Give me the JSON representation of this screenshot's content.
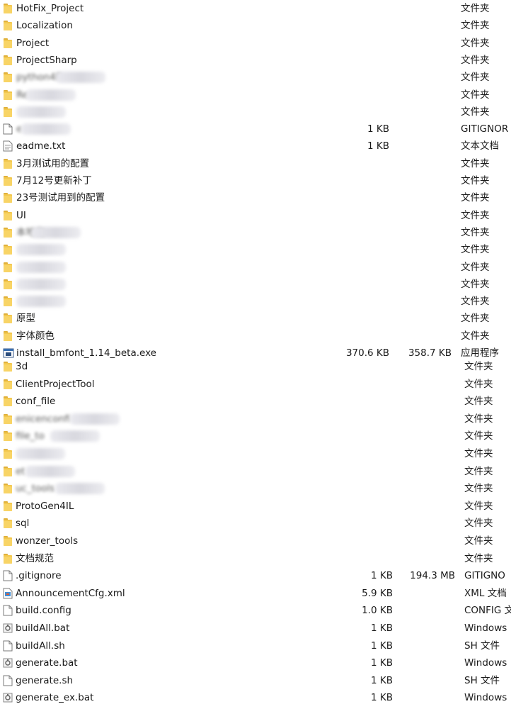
{
  "section1": {
    "rows": [
      {
        "name": "HotFix_Project",
        "size": "",
        "size2": "",
        "type": "文件夹",
        "icon": "folder-icon"
      },
      {
        "name": "Localization",
        "size": "",
        "size2": "",
        "type": "文件夹",
        "icon": "folder-icon"
      },
      {
        "name": "Project",
        "size": "",
        "size2": "",
        "type": "文件夹",
        "icon": "folder-icon"
      },
      {
        "name": "ProjectSharp",
        "size": "",
        "size2": "",
        "type": "文件夹",
        "icon": "folder-icon"
      },
      {
        "name": "python4P",
        "size": "",
        "size2": "",
        "type": "文件夹",
        "icon": "folder-icon",
        "blurred": true
      },
      {
        "name": "Re",
        "size": "",
        "size2": "",
        "type": "文件夹",
        "icon": "folder-icon",
        "blurred": true
      },
      {
        "name": "",
        "size": "",
        "size2": "",
        "type": "文件夹",
        "icon": "folder-icon",
        "blurred": true
      },
      {
        "name": "e",
        "size": "1 KB",
        "size2": "",
        "type": "GITIGNOR",
        "icon": "file-icon",
        "blurred": true
      },
      {
        "name": "eadme.txt",
        "size": "1 KB",
        "size2": "",
        "type": "文本文档",
        "icon": "text-file-icon"
      },
      {
        "name": "3月测试用的配置",
        "size": "",
        "size2": "",
        "type": "文件夹",
        "icon": "folder-icon"
      },
      {
        "name": "7月12号更新补丁",
        "size": "",
        "size2": "",
        "type": "文件夹",
        "icon": "folder-icon"
      },
      {
        "name": "23号测试用到的配置",
        "size": "",
        "size2": "",
        "type": "文件夹",
        "icon": "folder-icon"
      },
      {
        "name": "UI",
        "size": "",
        "size2": "",
        "type": "文件夹",
        "icon": "folder-icon"
      },
      {
        "name": "本地化",
        "size": "",
        "size2": "",
        "type": "文件夹",
        "icon": "folder-icon",
        "blurred": true
      },
      {
        "name": "",
        "size": "",
        "size2": "",
        "type": "文件夹",
        "icon": "folder-icon",
        "blurred": true
      },
      {
        "name": "",
        "size": "",
        "size2": "",
        "type": "文件夹",
        "icon": "folder-icon",
        "blurred": true
      },
      {
        "name": "",
        "size": "",
        "size2": "",
        "type": "文件夹",
        "icon": "folder-icon",
        "blurred": true
      },
      {
        "name": "",
        "size": "",
        "size2": "",
        "type": "文件夹",
        "icon": "folder-icon",
        "blurred": true
      },
      {
        "name": "原型",
        "size": "",
        "size2": "",
        "type": "文件夹",
        "icon": "folder-icon"
      },
      {
        "name": "字体颜色",
        "size": "",
        "size2": "",
        "type": "文件夹",
        "icon": "folder-icon"
      },
      {
        "name": "install_bmfont_1.14_beta.exe",
        "size": "370.6 KB",
        "size2": "358.7 KB",
        "type": "应用程序",
        "icon": "exe-icon"
      }
    ]
  },
  "section2": {
    "rows": [
      {
        "name": "3d",
        "size": "",
        "size2": "",
        "type": "文件夹",
        "icon": "folder-icon"
      },
      {
        "name": "ClientProjectTool",
        "size": "",
        "size2": "",
        "type": "文件夹",
        "icon": "folder-icon"
      },
      {
        "name": "conf_file",
        "size": "",
        "size2": "",
        "type": "文件夹",
        "icon": "folder-icon"
      },
      {
        "name": "enicenconfi",
        "size": "",
        "size2": "",
        "type": "文件夹",
        "icon": "folder-icon",
        "blurred": true
      },
      {
        "name": "file_to",
        "size": "",
        "size2": "",
        "type": "文件夹",
        "icon": "folder-icon",
        "blurred": true
      },
      {
        "name": "",
        "size": "",
        "size2": "",
        "type": "文件夹",
        "icon": "folder-icon",
        "blurred": true
      },
      {
        "name": "et",
        "size": "",
        "size2": "",
        "type": "文件夹",
        "icon": "folder-icon",
        "blurred": true
      },
      {
        "name": "uc_tools",
        "size": "",
        "size2": "",
        "type": "文件夹",
        "icon": "folder-icon",
        "blurred": true
      },
      {
        "name": "ProtoGen4IL",
        "size": "",
        "size2": "",
        "type": "文件夹",
        "icon": "folder-icon"
      },
      {
        "name": "sql",
        "size": "",
        "size2": "",
        "type": "文件夹",
        "icon": "folder-icon"
      },
      {
        "name": "wonzer_tools",
        "size": "",
        "size2": "",
        "type": "文件夹",
        "icon": "folder-icon"
      },
      {
        "name": "文档规范",
        "size": "",
        "size2": "",
        "type": "文件夹",
        "icon": "folder-icon"
      },
      {
        "name": ".gitignore",
        "size": "1 KB",
        "size2": "194.3 MB",
        "type": "GITIGNO",
        "icon": "file-icon"
      },
      {
        "name": "AnnouncementCfg.xml",
        "size": "5.9 KB",
        "size2": "",
        "type": "XML 文档",
        "icon": "xml-file-icon"
      },
      {
        "name": "build.config",
        "size": "1.0 KB",
        "size2": "",
        "type": "CONFIG 文",
        "icon": "file-icon"
      },
      {
        "name": "buildAll.bat",
        "size": "1 KB",
        "size2": "",
        "type": "Windows",
        "icon": "bat-file-icon"
      },
      {
        "name": "buildAll.sh",
        "size": "1 KB",
        "size2": "",
        "type": "SH 文件",
        "icon": "file-icon"
      },
      {
        "name": "generate.bat",
        "size": "1 KB",
        "size2": "",
        "type": "Windows",
        "icon": "bat-file-icon"
      },
      {
        "name": "generate.sh",
        "size": "1 KB",
        "size2": "",
        "type": "SH 文件",
        "icon": "file-icon"
      },
      {
        "name": "generate_ex.bat",
        "size": "1 KB",
        "size2": "",
        "type": "Windows",
        "icon": "bat-file-icon"
      }
    ]
  }
}
